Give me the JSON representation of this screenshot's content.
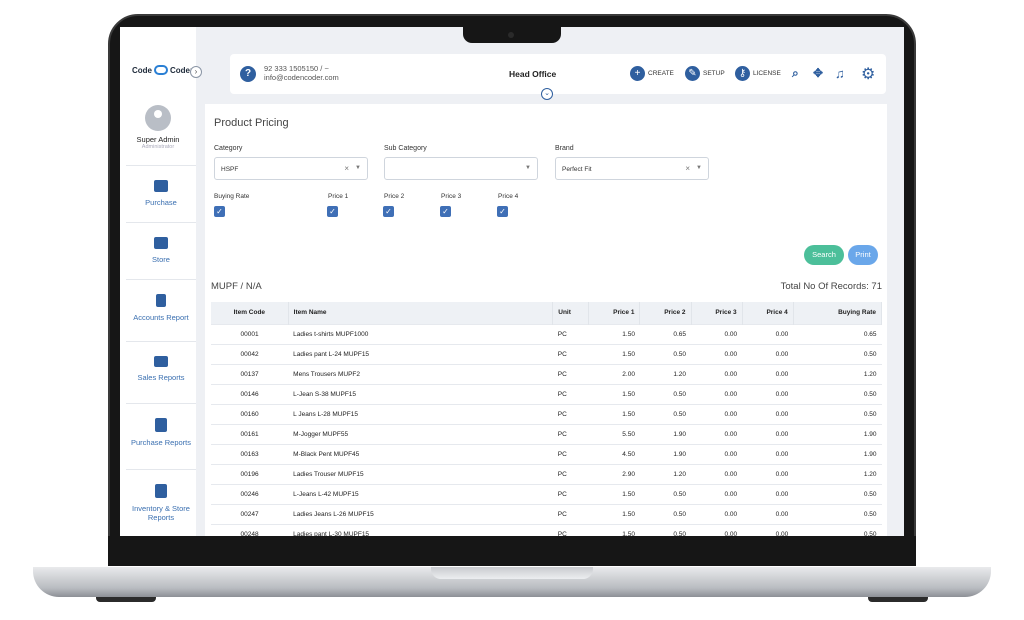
{
  "brand": {
    "logo_text_left": "Code",
    "logo_text_right": "Coder"
  },
  "sidebar": {
    "user_name": "Super Admin",
    "user_role": "Administrator",
    "items": [
      {
        "label": "Purchase",
        "icon": "credit-card-icon"
      },
      {
        "label": "Store",
        "icon": "archive-box-icon"
      },
      {
        "label": "Accounts Report",
        "icon": "document-icon"
      },
      {
        "label": "Sales Reports",
        "icon": "list-icon"
      },
      {
        "label": "Purchase Reports",
        "icon": "copy-documents-icon"
      },
      {
        "label": "Inventory & Store Reports",
        "icon": "copy-documents-icon"
      }
    ]
  },
  "topbar": {
    "phone": "92 333 1505150 / ~",
    "email": "info@codencoder.com",
    "branch": "Head Office",
    "create_label": "CREATE",
    "setup_label": "SETUP",
    "license_label": "LICENSE"
  },
  "page": {
    "title": "Product Pricing",
    "filters": {
      "category_label": "Category",
      "category_value": "HSPF",
      "subcategory_label": "Sub Category",
      "subcategory_value": "",
      "brand_label": "Brand",
      "brand_value": "Perfect Fit"
    },
    "checkboxes": [
      "Buying Rate",
      "Price 1",
      "Price 2",
      "Price 3",
      "Price 4"
    ],
    "search_label": "Search",
    "print_label": "Print",
    "group_title": "MUPF / N/A",
    "records_text": "Total No Of Records: 71"
  },
  "table": {
    "columns": [
      "Item Code",
      "Item Name",
      "Unit",
      "Price 1",
      "Price 2",
      "Price 3",
      "Price 4",
      "Buying Rate"
    ],
    "rows": [
      [
        "00001",
        "Ladies t-shirts MUPF1000",
        "PC",
        "1.50",
        "0.65",
        "0.00",
        "0.00",
        "0.65"
      ],
      [
        "00042",
        "Ladies pant L-24 MUPF15",
        "PC",
        "1.50",
        "0.50",
        "0.00",
        "0.00",
        "0.50"
      ],
      [
        "00137",
        "Mens Trousers MUPF2",
        "PC",
        "2.00",
        "1.20",
        "0.00",
        "0.00",
        "1.20"
      ],
      [
        "00146",
        "L-Jean S-38 MUPF15",
        "PC",
        "1.50",
        "0.50",
        "0.00",
        "0.00",
        "0.50"
      ],
      [
        "00160",
        "L Jeans L-28 MUPF15",
        "PC",
        "1.50",
        "0.50",
        "0.00",
        "0.00",
        "0.50"
      ],
      [
        "00161",
        "M-Jogger MUPF55",
        "PC",
        "5.50",
        "1.90",
        "0.00",
        "0.00",
        "1.90"
      ],
      [
        "00163",
        "M-Black Pent MUPF45",
        "PC",
        "4.50",
        "1.90",
        "0.00",
        "0.00",
        "1.90"
      ],
      [
        "00196",
        "Ladies Trouser MUPF15",
        "PC",
        "2.90",
        "1.20",
        "0.00",
        "0.00",
        "1.20"
      ],
      [
        "00246",
        "L-Jeans L-42 MUPF15",
        "PC",
        "1.50",
        "0.50",
        "0.00",
        "0.00",
        "0.50"
      ],
      [
        "00247",
        "Ladies Jeans L-26 MUPF15",
        "PC",
        "1.50",
        "0.50",
        "0.00",
        "0.00",
        "0.50"
      ],
      [
        "00248",
        "Ladies pant L-30 MUPF15",
        "PC",
        "1.50",
        "0.50",
        "0.00",
        "0.00",
        "0.50"
      ]
    ]
  }
}
